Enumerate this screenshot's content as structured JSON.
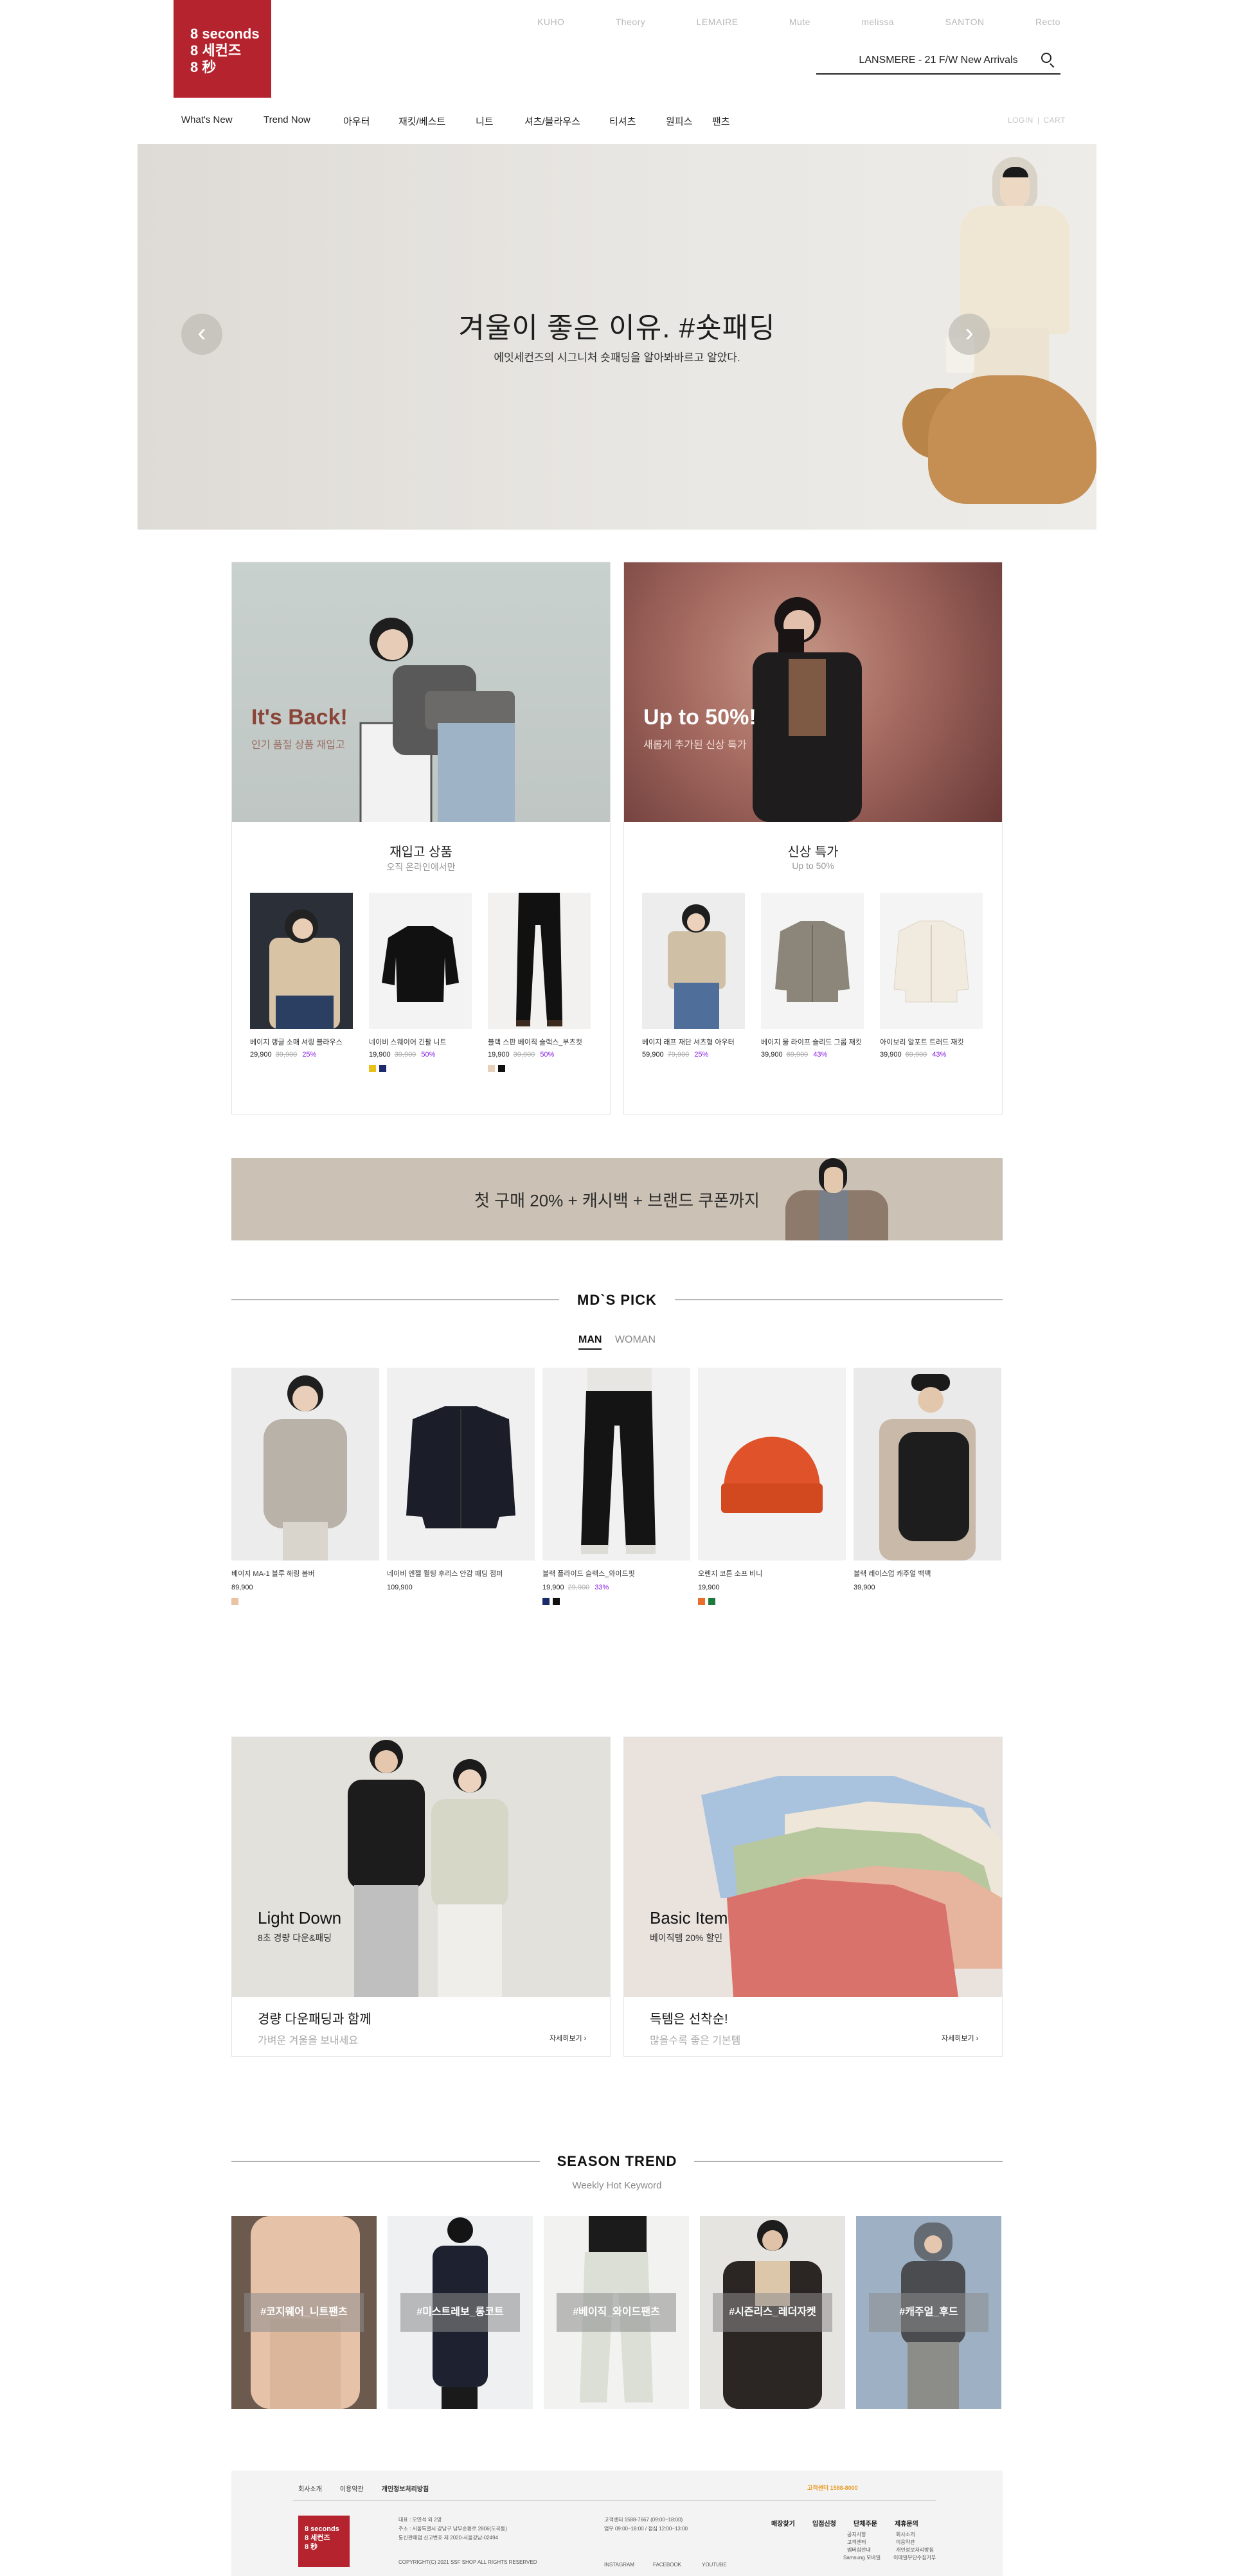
{
  "header": {
    "logo_lines": [
      "8 seconds",
      "8 세컨즈",
      "8 秒"
    ],
    "brand_links": [
      "KUHO",
      "Theory",
      "LEMAIRE",
      "Mute",
      "melissa",
      "SANTON",
      "Recto"
    ],
    "search_text": "LANSMERE - 21 F/W New Arrivals",
    "gnb": [
      "What's New",
      "Trend Now",
      "아우터",
      "재킷/베스트",
      "니트",
      "셔츠/블라우스",
      "티셔츠",
      "원피스",
      "팬츠"
    ],
    "util": [
      "LOGIN",
      "CART"
    ]
  },
  "hero": {
    "title": "겨울이 좋은 이유. #숏패딩",
    "subtitle": "에잇세컨즈의 시그니처 숏패딩을 알아봐바르고 알았다.",
    "prev_icon": "‹",
    "next_icon": "›"
  },
  "promo": [
    {
      "img_title": "It's Back!",
      "img_sub": "인기 품절 상품 재입고",
      "head": "재입고 상품",
      "sub": "오직 온라인에서만",
      "products": [
        {
          "name": "베이지 랭글 소매 셔링 블라우스",
          "price": "29,900",
          "old": "39,900",
          "rate": "25%",
          "swatches": []
        },
        {
          "name": "네이비 스웨이어 긴팔 니트",
          "price": "19,900",
          "old": "39,900",
          "rate": "50%",
          "swatches": [
            "#e8c21a",
            "#1d2a6b"
          ]
        },
        {
          "name": "블랙 스판 베이직 슬랙스_부츠컷",
          "price": "19,900",
          "old": "39,900",
          "rate": "50%",
          "swatches": [
            "#e6d0b8",
            "#111111"
          ]
        }
      ]
    },
    {
      "img_title": "Up to 50%!",
      "img_sub": "새롭게 추가된 신상 특가",
      "head": "신상 특가",
      "sub": "Up to 50%",
      "products": [
        {
          "name": "베이지 래프 재단 셔츠형 아우터",
          "price": "59,900",
          "old": "79,900",
          "rate": "25%",
          "swatches": []
        },
        {
          "name": "베이지 울 라이프 슬리드 그룹 재킷",
          "price": "39,900",
          "old": "69,900",
          "rate": "43%",
          "swatches": []
        },
        {
          "name": "아이보리 알포트 트러드 재킷",
          "price": "39,900",
          "old": "69,900",
          "rate": "43%",
          "swatches": []
        }
      ]
    }
  ],
  "banner": {
    "text": "첫 구매 20% + 캐시백 + 브랜드 쿠폰까지"
  },
  "mds_pick": {
    "title": "MD`S PICK",
    "tabs": [
      "MAN",
      "WOMAN"
    ],
    "items": [
      {
        "name": "베이지 MA-1 블루 해링 봄버",
        "price": "89,900",
        "old": "",
        "rate": "",
        "swatches": [
          "#e9c3a4"
        ]
      },
      {
        "name": "네이비 엔젤 퀼팅 후리스 안감 패딩 점퍼",
        "price": "109,900",
        "old": "",
        "rate": "",
        "swatches": []
      },
      {
        "name": "블랙 플라이드 슬렉스_와이드핏",
        "price": "19,900",
        "old": "29,900",
        "rate": "33%",
        "swatches": [
          "#1b2a6a",
          "#111111"
        ]
      },
      {
        "name": "오렌지 코튼 소프 비니",
        "price": "19,900",
        "old": "",
        "rate": "",
        "swatches": [
          "#e86e2c",
          "#1d7a3e"
        ]
      },
      {
        "name": "블랙 레이스업 캐주얼 백팩",
        "price": "39,900",
        "old": "",
        "rate": "",
        "swatches": []
      }
    ]
  },
  "features": [
    {
      "img_title": "Light Down",
      "img_sub": "8초 경량 다운&패딩",
      "head": "경량 다운패딩과 함께",
      "sub": "가벼운 겨울을 보내세요",
      "more": "자세히보기 ›"
    },
    {
      "img_title": "Basic Item",
      "img_sub": "베이직템 20% 할인",
      "head": "득템은 선착순!",
      "sub": "많을수록 좋은 기본템",
      "more": "자세히보기 ›"
    }
  ],
  "season_trend": {
    "title": "SEASON TREND",
    "subtitle": "Weekly Hot Keyword",
    "tags": [
      "#코지웨어_니트팬츠",
      "#미스트레보_롱코트",
      "#베이직_와이드팬츠",
      "#시즌리스_레더자켓",
      "#캐주얼_후드"
    ]
  },
  "footer": {
    "links": [
      "회사소개",
      "이용약관",
      "개인정보처리방침"
    ],
    "cs": "고객센터 1588-8000",
    "logo_lines": [
      "8 seconds",
      "8 세컨즈",
      "8 秒"
    ],
    "addr": [
      "대표 : 오연석 외 2명",
      "주소 : 서울특별시 강남구 남부순환로 2806(도곡동)",
      "통신판매업 신고번호 제 2020-서울강남-02494"
    ],
    "copyright": "COPYRIGHT(C) 2021 SSF SHOP ALL RIGHTS RESERVED",
    "contact": [
      "고객센터 1588-7667 (09:00~18:00)",
      "업무 09:00~18:00 / 점심 12:00~13:00"
    ],
    "sns": [
      "INSTAGRAM",
      "FACEBOOK",
      "YOUTUBE"
    ],
    "cols": [
      {
        "head": "매장찾기",
        "items": []
      },
      {
        "head": "입점신청",
        "items": []
      },
      {
        "head": "단체주문",
        "items": [
          "공지사항",
          "고객센터",
          "멤버십안내",
          "Samsung 모바일"
        ]
      },
      {
        "head": "제휴문의",
        "items": [
          "회사소개",
          "이용약관",
          "개인정보처리방침",
          "이메일무단수집거부"
        ]
      }
    ]
  }
}
